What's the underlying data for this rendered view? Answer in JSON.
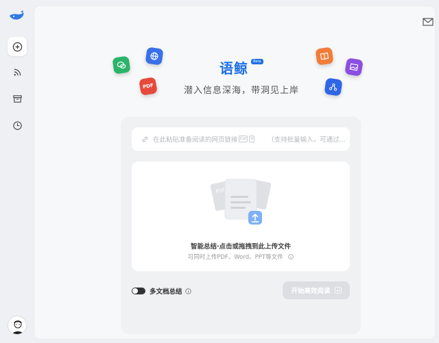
{
  "brand": {
    "name": "语鲸",
    "badge": "Beta",
    "slogan": "潜入信息深海，带洞见上岸",
    "accent_color": "#1f6fe5"
  },
  "sidebar": {
    "items": [
      {
        "icon": "add-circle-icon"
      },
      {
        "icon": "rss-icon"
      },
      {
        "icon": "archive-icon"
      },
      {
        "icon": "clock-icon"
      }
    ]
  },
  "header": {
    "mail_icon": "mail-icon"
  },
  "url_input": {
    "placeholder_main": "在此粘贴准备阅读的网页链接",
    "key_ctrl": "Ctrl",
    "key_v": "V",
    "placeholder_hint": "（支持批量输入，可通过..."
  },
  "upload": {
    "title": "智能总结·点击或拖拽到此上传文件",
    "subtitle": "可同时上传PDF、Word、PPT等文件",
    "illustration_label": "PDF"
  },
  "options": {
    "multi_doc_label": "多文档总结",
    "multi_doc_enabled": true
  },
  "actions": {
    "start_label": "开始高效阅读"
  },
  "floating_icons": {
    "pdf_label": "PDF"
  }
}
